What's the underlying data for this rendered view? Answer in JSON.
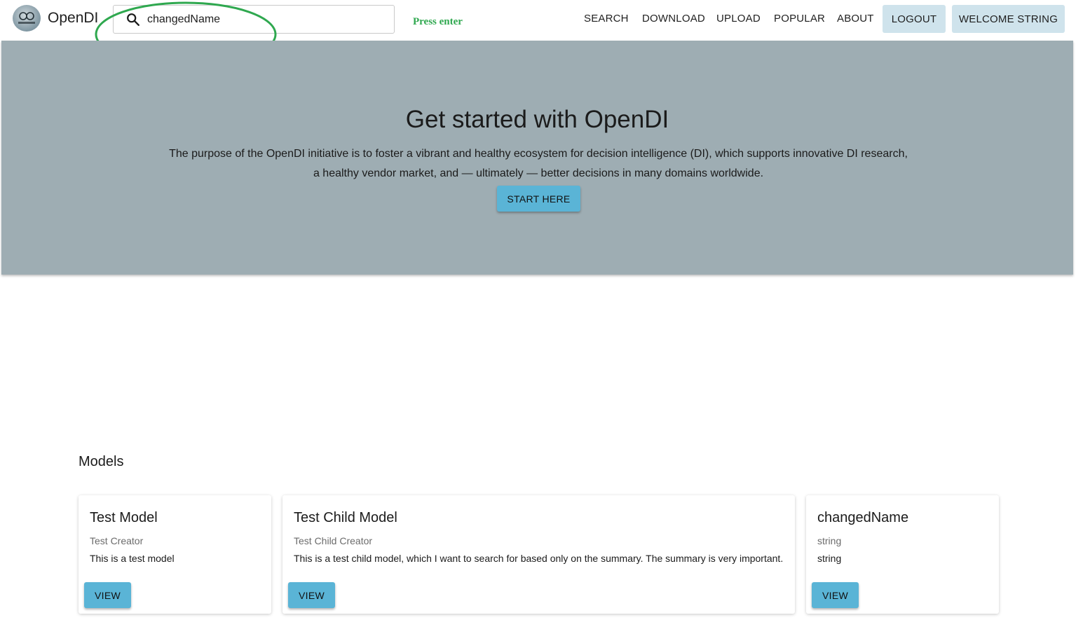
{
  "header": {
    "app_title": "OpenDI",
    "logo_icon": "opendi-logo-icon",
    "search": {
      "value": "changedName",
      "placeholder": "",
      "icon": "search-icon"
    },
    "annotation": {
      "text": "Press enter",
      "color": "#2fa84f"
    },
    "nav": {
      "search": "SEARCH",
      "download": "DOWNLOAD",
      "upload": "UPLOAD",
      "popular": "POPULAR",
      "about": "ABOUT",
      "logout": "LOGOUT",
      "welcome": "WELCOME STRING"
    }
  },
  "hero": {
    "title": "Get started with OpenDI",
    "line1": "The purpose of the OpenDI initiative is to foster a vibrant and healthy ecosystem for decision intelligence (DI), which supports innovative DI research,",
    "line2": "a healthy vendor market, and — ultimately — better decisions in many domains worldwide.",
    "cta": "START HERE",
    "background": "#9eadb3"
  },
  "models": {
    "title": "Models",
    "cards": [
      {
        "title": "Test Model",
        "creator": "Test Creator",
        "summary": "This is a test model",
        "action": "VIEW"
      },
      {
        "title": "Test Child Model",
        "creator": "Test Child Creator",
        "summary": "This is a test child model, which I want to search for based only on the summary. The summary is very important.",
        "action": "VIEW"
      },
      {
        "title": "changedName",
        "creator": "string",
        "summary": "string",
        "action": "VIEW"
      }
    ]
  },
  "colors": {
    "accent_button": "#5ab4d6",
    "nav_button": "#cfe3ec"
  }
}
